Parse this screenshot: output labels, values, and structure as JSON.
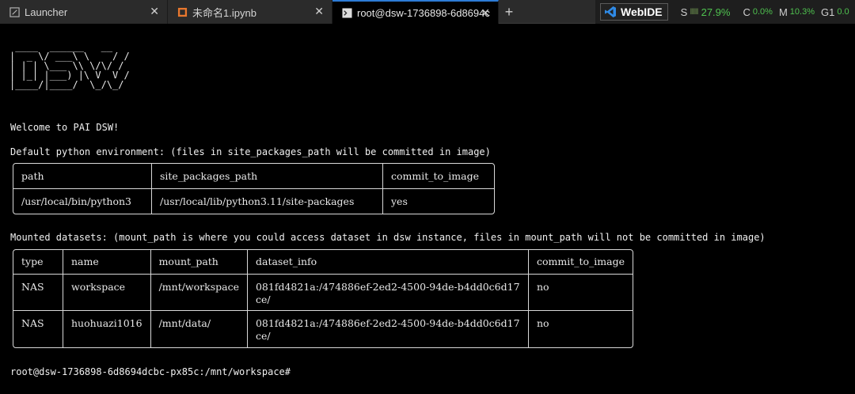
{
  "tabs": [
    {
      "label": "Launcher",
      "icon": "launcher-icon",
      "close": "✕"
    },
    {
      "label": "未命名1.ipynb",
      "icon": "notebook-icon",
      "close": "✕"
    },
    {
      "label": "root@dsw-1736898-6d8694c",
      "icon": "terminal-icon",
      "close": "✕"
    }
  ],
  "add_tab": "+",
  "status": {
    "webide_label": "WebIDE",
    "s_label": "S",
    "s_bars": "IIIII",
    "s_value": "27.9%",
    "c_label": "C",
    "c_value": "0.0%",
    "m_label": "M",
    "m_value": "10.3%",
    "g_label": "G1",
    "g_value": "0.0",
    "accent": "#4fc24f"
  },
  "terminal": {
    "logo_lines": [
      " ____  ______   __",
      "|  _ \\/ ___\\ \\    / /",
      "| | | \\___ \\\\ \\/\\/ /",
      "| |_| |___) |\\ V  V /",
      "|____/|____/  \\_/\\_/"
    ],
    "welcome": "Welcome to PAI DSW!",
    "env_intro": "Default python environment: (files in site_packages_path will be committed in image)",
    "env_table": {
      "headers": [
        "path",
        "site_packages_path",
        "commit_to_image"
      ],
      "rows": [
        [
          "/usr/local/bin/python3",
          "/usr/local/lib/python3.11/site-packages",
          "yes"
        ]
      ]
    },
    "mount_intro": "Mounted datasets: (mount_path is where you could access dataset in dsw instance, files in mount_path will not be committed in image)",
    "ds_table": {
      "headers": [
        "type",
        "name",
        "mount_path",
        "dataset_info",
        "commit_to_image"
      ],
      "rows": [
        [
          "NAS",
          "workspace",
          "/mnt/workspace",
          "081fd4821a:/474886ef-2ed2-4500-94de-b4dd0c6d17ce/",
          "no"
        ],
        [
          "NAS",
          "huohuazi1016",
          "/mnt/data/",
          "081fd4821a:/474886ef-2ed2-4500-94de-b4dd0c6d17ce/",
          "no"
        ]
      ]
    },
    "prompt": "root@dsw-1736898-6d8694dcbc-px85c:/mnt/workspace#"
  }
}
